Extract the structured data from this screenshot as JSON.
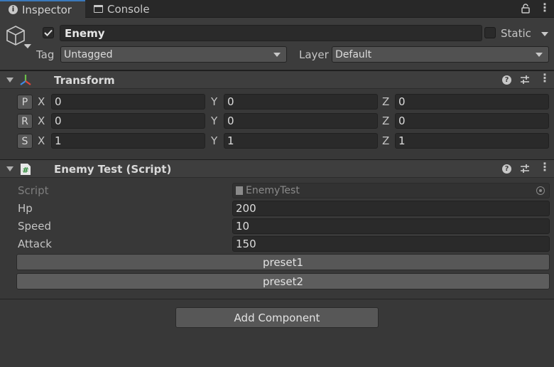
{
  "tabs": [
    {
      "label": "Inspector",
      "icon": "info-icon"
    },
    {
      "label": "Console",
      "icon": "console-icon"
    }
  ],
  "header": {
    "object_name": "Enemy",
    "active": true,
    "static_label": "Static",
    "tag_label": "Tag",
    "tag_value": "Untagged",
    "layer_label": "Layer",
    "layer_value": "Default"
  },
  "transform": {
    "title": "Transform",
    "rows": [
      {
        "button": "P",
        "x": "0",
        "y": "0",
        "z": "0"
      },
      {
        "button": "R",
        "x": "0",
        "y": "0",
        "z": "0"
      },
      {
        "button": "S",
        "x": "1",
        "y": "1",
        "z": "1"
      }
    ],
    "axes": [
      "X",
      "Y",
      "Z"
    ]
  },
  "script_component": {
    "title": "Enemy Test (Script)",
    "script_label": "Script",
    "script_value": "EnemyTest",
    "fields": [
      {
        "label": "Hp",
        "value": "200"
      },
      {
        "label": "Speed",
        "value": "10"
      },
      {
        "label": "Attack",
        "value": "150"
      }
    ],
    "buttons": [
      "preset1",
      "preset2"
    ]
  },
  "add_component_label": "Add Component",
  "colors": {
    "accent": "#3a79bb",
    "panel": "#383838",
    "field": "#2a2a2a",
    "transform_red": "#e0443a",
    "transform_green": "#6cc04a",
    "transform_blue": "#3e8ae6"
  }
}
